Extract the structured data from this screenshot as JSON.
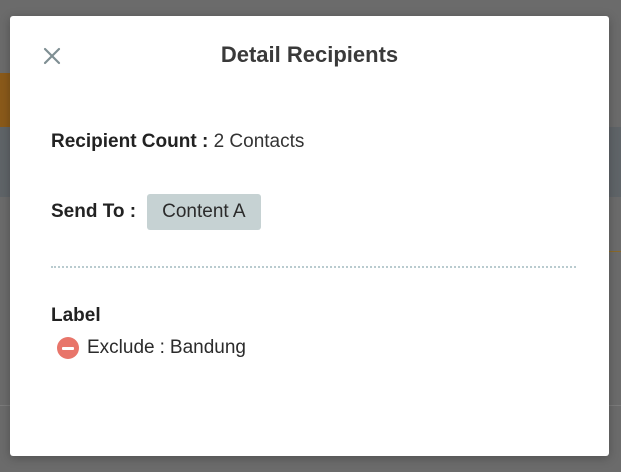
{
  "modal": {
    "title": "Detail Recipients",
    "recipient_count_label": "Recipient Count :",
    "recipient_count_value": "2 Contacts",
    "send_to_label": "Send To :",
    "send_to_chips": [
      "Content A"
    ],
    "label_heading": "Label",
    "labels": [
      {
        "icon": "minus-circle-icon",
        "type": "Exclude",
        "separator": ":",
        "value": "Bandung"
      }
    ]
  },
  "colors": {
    "overlay": "#6b6b6b",
    "chip_bg": "#c6d2d3",
    "exclude_icon": "#e8756a",
    "divider": "#b9cbcf"
  }
}
